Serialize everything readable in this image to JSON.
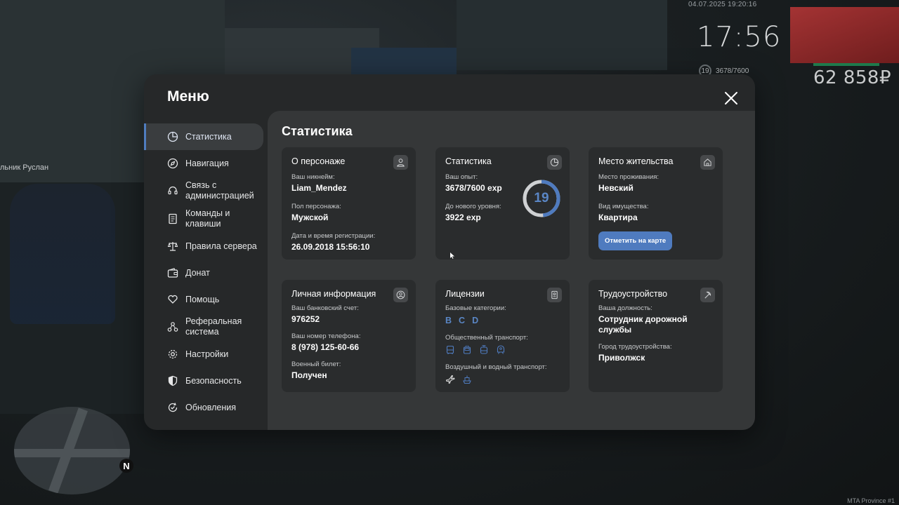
{
  "hud": {
    "timestamp": "04.07.2025 19:20:16",
    "clock": "17:56",
    "level": "19",
    "exp": "3678/7600",
    "money": "62 858₽",
    "npc_name": "льник Руслан",
    "minimap_north": "N",
    "watermark": "MTA Province #1"
  },
  "menu": {
    "title": "Меню",
    "sidebar": [
      {
        "label": "Статистика",
        "icon": "pie-chart-icon",
        "active": true
      },
      {
        "label": "Навигация",
        "icon": "compass-icon",
        "active": false
      },
      {
        "label": "Связь с администрацией",
        "icon": "headset-icon",
        "active": false
      },
      {
        "label": "Команды и клавиши",
        "icon": "document-icon",
        "active": false
      },
      {
        "label": "Правила сервера",
        "icon": "scales-icon",
        "active": false
      },
      {
        "label": "Донат",
        "icon": "wallet-icon",
        "active": false
      },
      {
        "label": "Помощь",
        "icon": "heart-hands-icon",
        "active": false
      },
      {
        "label": "Реферальная система",
        "icon": "network-icon",
        "active": false
      },
      {
        "label": "Настройки",
        "icon": "gear-icon",
        "active": false
      },
      {
        "label": "Безопасность",
        "icon": "shield-icon",
        "active": false
      },
      {
        "label": "Обновления",
        "icon": "refresh-check-icon",
        "active": false
      }
    ]
  },
  "content": {
    "title": "Статистика",
    "character": {
      "title": "О персонаже",
      "icon": "user-icon",
      "nickname_label": "Ваш никнейм:",
      "nickname": "Liam_Mendez",
      "gender_label": "Пол персонажа:",
      "gender": "Мужской",
      "reg_label": "Дата и время регистрации:",
      "reg": "26.09.2018 15:56:10"
    },
    "stats": {
      "title": "Статистика",
      "icon": "pie-chart-icon",
      "exp_label": "Ваш опыт:",
      "exp": "3678/7600 exp",
      "next_label": "До нового уровня:",
      "next": "3922 exp",
      "level": "19",
      "level_progress": 0.484
    },
    "residence": {
      "title": "Место жительства",
      "icon": "home-icon",
      "place_label": "Место проживания:",
      "place": "Невский",
      "type_label": "Вид имущества:",
      "type": "Квартира",
      "button": "Отметить на карте"
    },
    "personal": {
      "title": "Личная информация",
      "icon": "user-circle-icon",
      "bank_label": "Ваш банковский счет:",
      "bank": "976252",
      "phone_label": "Ваш номер телефона:",
      "phone": "8 (978) 125-60-66",
      "military_label": "Военный билет:",
      "military": "Получен"
    },
    "licenses": {
      "title": "Лицензии",
      "icon": "id-card-icon",
      "base_label": "Базовые категории:",
      "base": [
        "B",
        "C",
        "D"
      ],
      "public_label": "Общественный транспорт:",
      "public_icons": [
        "bus-icon",
        "trolleybus-icon",
        "tram-icon",
        "metro-icon"
      ],
      "air_label": "Воздушный и водный транспорт:",
      "air_icons": [
        "plane-icon",
        "ship-icon"
      ]
    },
    "job": {
      "title": "Трудоустройство",
      "icon": "pickaxe-icon",
      "position_label": "Ваша должность:",
      "position": "Сотрудник дорожной службы",
      "city_label": "Город трудоустройства:",
      "city": "Приволжск"
    }
  },
  "colors": {
    "accent": "#4f7bbf",
    "window_bg": "#262829",
    "panel_bg": "#353738",
    "card_bg": "#2a2c2d"
  }
}
